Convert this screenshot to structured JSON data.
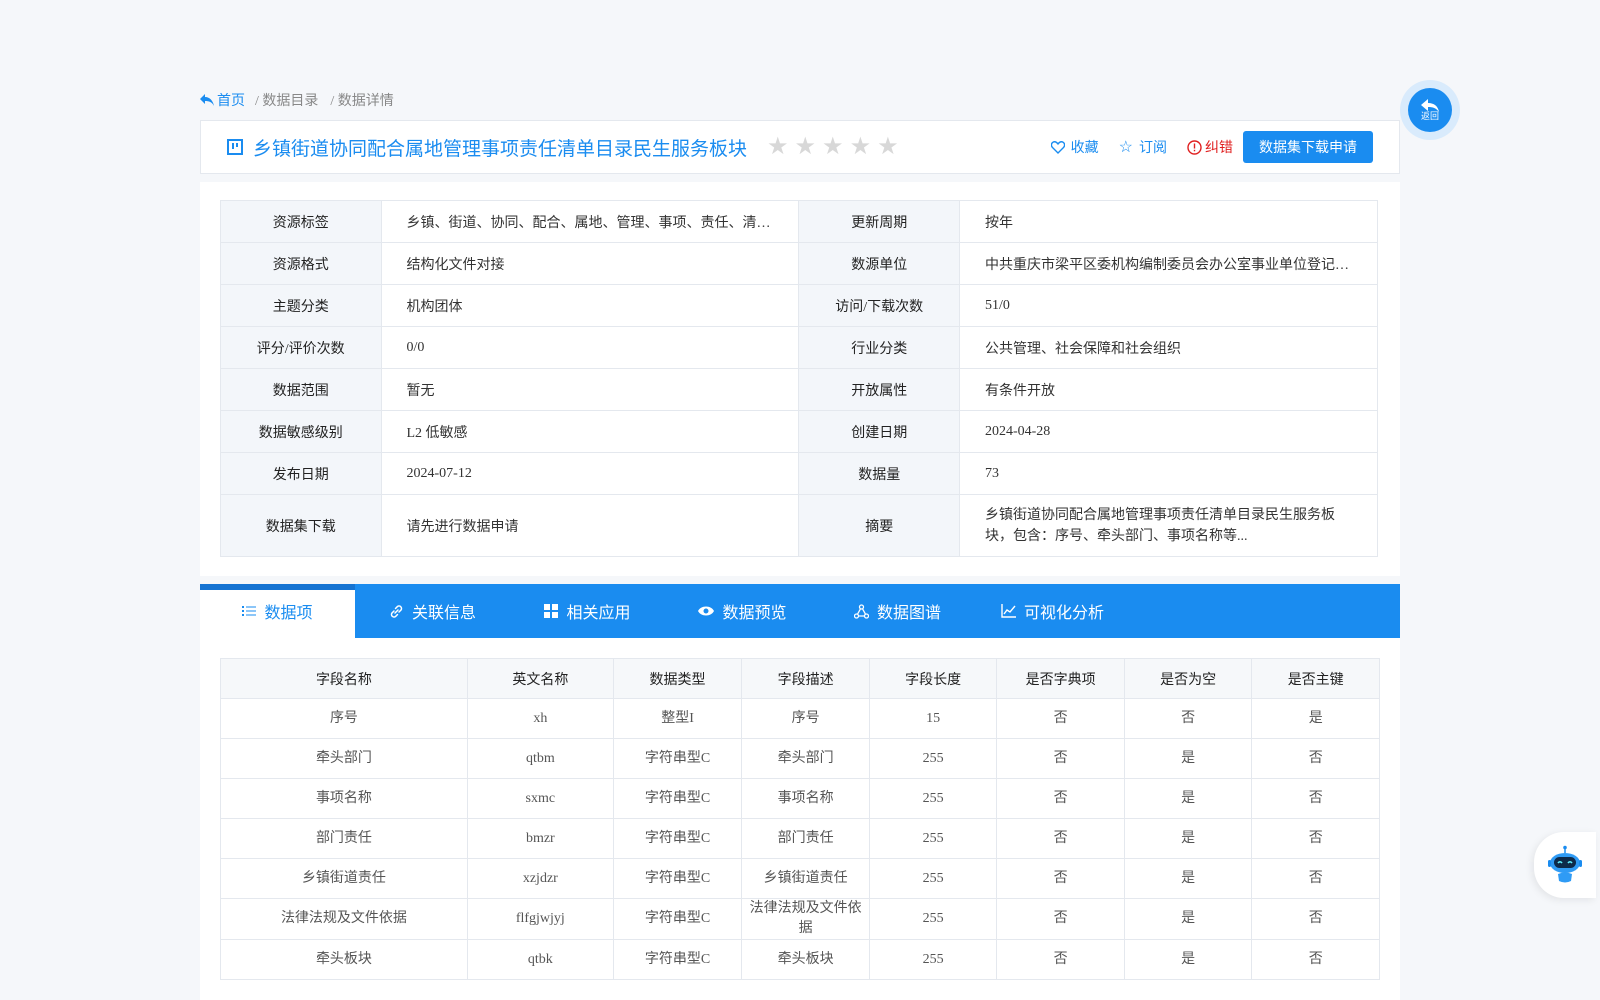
{
  "breadcrumb": {
    "home": "首页",
    "catalog": "/ 数据目录",
    "detail": "/ 数据详情"
  },
  "title": "乡镇街道协同配合属地管理事项责任清单目录民生服务板块",
  "rating": {
    "stars": 0,
    "max": 5
  },
  "actions": {
    "favorite": "收藏",
    "subscribe": "订阅",
    "report": "纠错",
    "apply": "数据集下载申请"
  },
  "info": {
    "rows": [
      {
        "l1": "资源标签",
        "v1": "乡镇、街道、协同、配合、属地、管理、事项、责任、清单、目录、民生、服务、板块",
        "l2": "更新周期",
        "v2": "按年"
      },
      {
        "l1": "资源格式",
        "v1": "结构化文件对接",
        "l2": "数源单位",
        "v2": "中共重庆市梁平区委机构编制委员会办公室事业单位登记管理局"
      },
      {
        "l1": "主题分类",
        "v1": "机构团体",
        "l2": "访问/下载次数",
        "v2": "51/0"
      },
      {
        "l1": "评分/评价次数",
        "v1": "0/0",
        "l2": "行业分类",
        "v2": "公共管理、社会保障和社会组织"
      },
      {
        "l1": "数据范围",
        "v1": "暂无",
        "l2": "开放属性",
        "v2": "有条件开放"
      },
      {
        "l1": "数据敏感级别",
        "v1": "L2 低敏感",
        "l2": "创建日期",
        "v2": "2024-04-28"
      },
      {
        "l1": "发布日期",
        "v1": "2024-07-12",
        "l2": "数据量",
        "v2": "73"
      }
    ],
    "download_label": "数据集下载",
    "download_value": "请先进行数据申请",
    "summary_label": "摘要",
    "summary_value": "乡镇街道协同配合属地管理事项责任清单目录民生服务板块，包含：序号、牵头部门、事项名称等..."
  },
  "tabs": [
    "数据项",
    "关联信息",
    "相关应用",
    "数据预览",
    "数据图谱",
    "可视化分析"
  ],
  "grid": {
    "headers": [
      "字段名称",
      "英文名称",
      "数据类型",
      "字段描述",
      "字段长度",
      "是否字典项",
      "是否为空",
      "是否主键"
    ],
    "rows": [
      [
        "序号",
        "xh",
        "整型I",
        "序号",
        "15",
        "否",
        "否",
        "是"
      ],
      [
        "牵头部门",
        "qtbm",
        "字符串型C",
        "牵头部门",
        "255",
        "否",
        "是",
        "否"
      ],
      [
        "事项名称",
        "sxmc",
        "字符串型C",
        "事项名称",
        "255",
        "否",
        "是",
        "否"
      ],
      [
        "部门责任",
        "bmzr",
        "字符串型C",
        "部门责任",
        "255",
        "否",
        "是",
        "否"
      ],
      [
        "乡镇街道责任",
        "xzjdzr",
        "字符串型C",
        "乡镇街道责任",
        "255",
        "否",
        "是",
        "否"
      ],
      [
        "法律法规及文件依据",
        "flfgjwjyj",
        "字符串型C",
        "法律法规及文件依据",
        "255",
        "否",
        "是",
        "否"
      ],
      [
        "牵头板块",
        "qtbk",
        "字符串型C",
        "牵头板块",
        "255",
        "否",
        "是",
        "否"
      ]
    ]
  },
  "back_label": "返回",
  "colors": {
    "accent": "#1a8cf0",
    "danger": "#e02020"
  }
}
